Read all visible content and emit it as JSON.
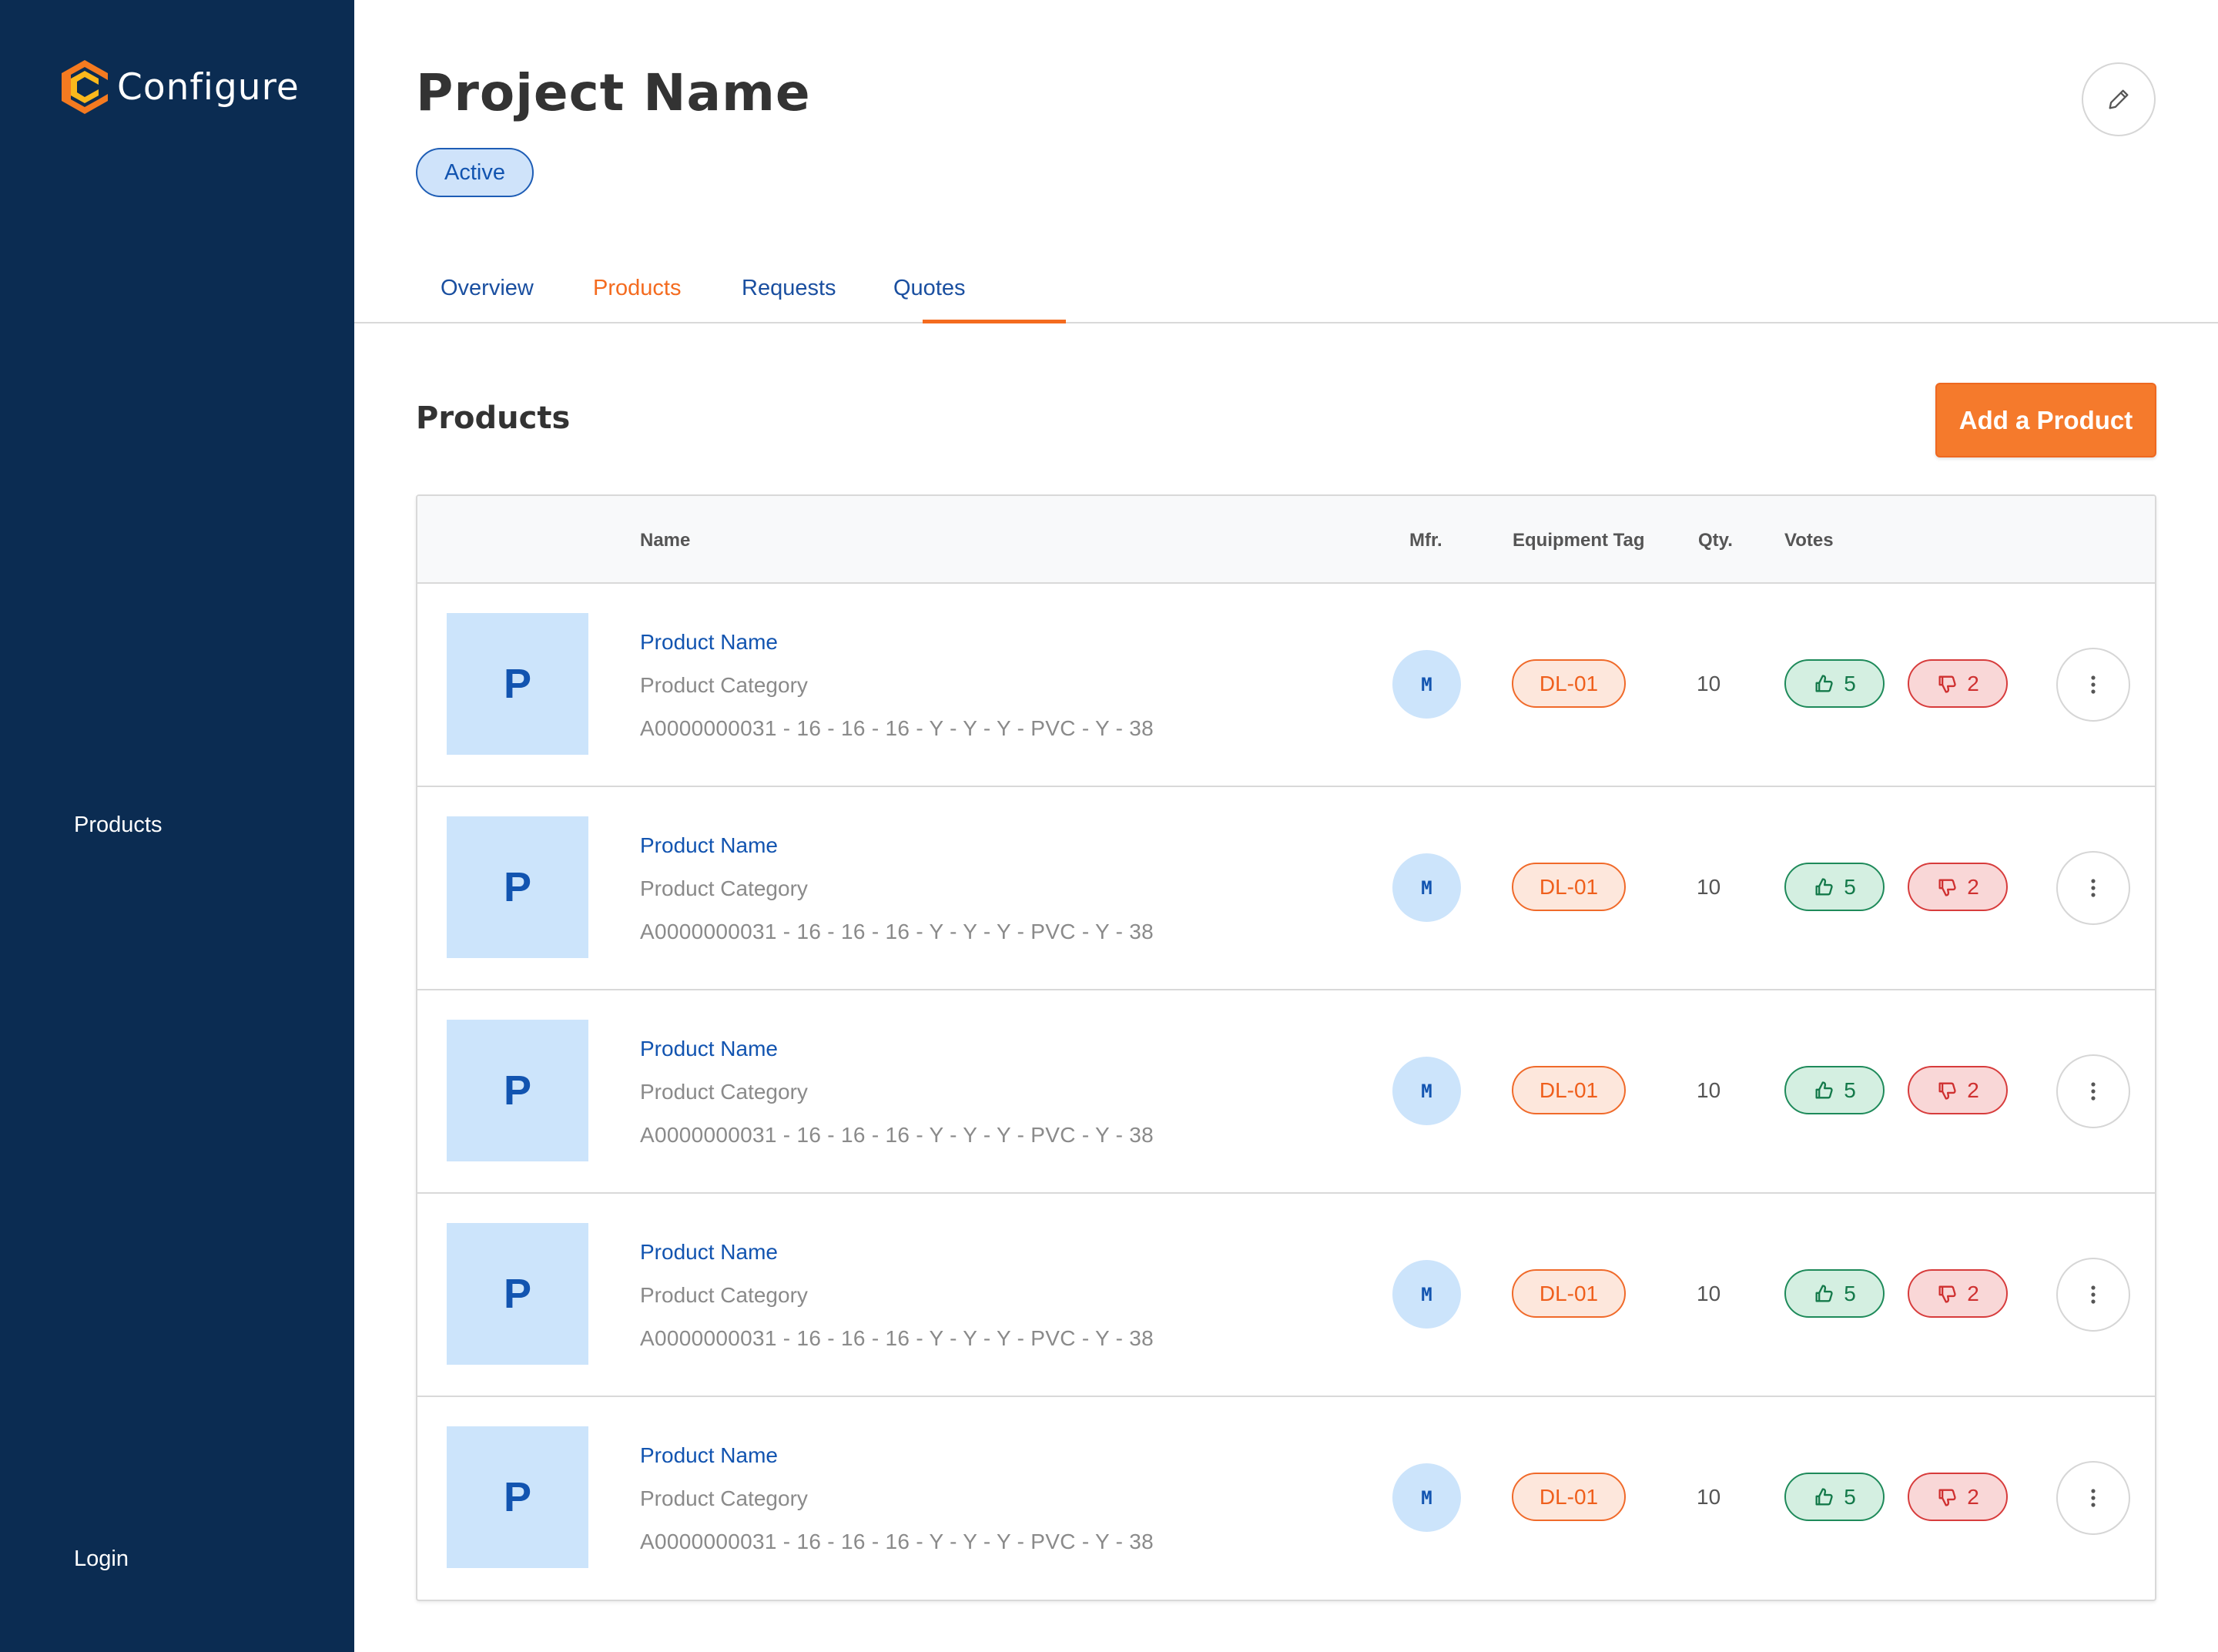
{
  "app": {
    "logo_text": "Configure",
    "brand_colors": {
      "logo_orange": "#f47a20",
      "logo_yellow": "#fbb81c",
      "sidebar": "#0b2c52"
    }
  },
  "sidebar": {
    "items": [
      {
        "label": "Products",
        "icon": "none"
      },
      {
        "label": "Login",
        "icon": "none"
      }
    ]
  },
  "header": {
    "title": "Project Name",
    "status": "Active",
    "edit_icon": "pencil-icon"
  },
  "tabs": [
    {
      "label": "Overview",
      "active": false
    },
    {
      "label": "Products",
      "active": true
    },
    {
      "label": "Requests",
      "active": false
    },
    {
      "label": "Quotes",
      "active": false
    }
  ],
  "section": {
    "title": "Products",
    "add_button": "Add a Product"
  },
  "table": {
    "columns": {
      "name": "Name",
      "mfr": "Mfr.",
      "equipment_tag": "Equipment Tag",
      "qty": "Qty.",
      "votes": "Votes"
    },
    "rows": [
      {
        "thumb": "P",
        "name": "Product Name",
        "category": "Product Category",
        "code": "A0000000031 - 16 - 16 - 16 - Y - Y - Y - PVC - Y - 38",
        "mfr": "M",
        "tag": "DL-01",
        "qty": "10",
        "up": "5",
        "down": "2"
      },
      {
        "thumb": "P",
        "name": "Product Name",
        "category": "Product Category",
        "code": "A0000000031 - 16 - 16 - 16 - Y - Y - Y - PVC - Y - 38",
        "mfr": "M",
        "tag": "DL-01",
        "qty": "10",
        "up": "5",
        "down": "2"
      },
      {
        "thumb": "P",
        "name": "Product Name",
        "category": "Product Category",
        "code": "A0000000031 - 16 - 16 - 16 - Y - Y - Y - PVC - Y - 38",
        "mfr": "M",
        "tag": "DL-01",
        "qty": "10",
        "up": "5",
        "down": "2"
      },
      {
        "thumb": "P",
        "name": "Product Name",
        "category": "Product Category",
        "code": "A0000000031 - 16 - 16 - 16 - Y - Y - Y - PVC - Y - 38",
        "mfr": "M",
        "tag": "DL-01",
        "qty": "10",
        "up": "5",
        "down": "2"
      },
      {
        "thumb": "P",
        "name": "Product Name",
        "category": "Product Category",
        "code": "A0000000031 - 16 - 16 - 16 - Y - Y - Y - PVC - Y - 38",
        "mfr": "M",
        "tag": "DL-01",
        "qty": "10",
        "up": "5",
        "down": "2"
      }
    ]
  }
}
